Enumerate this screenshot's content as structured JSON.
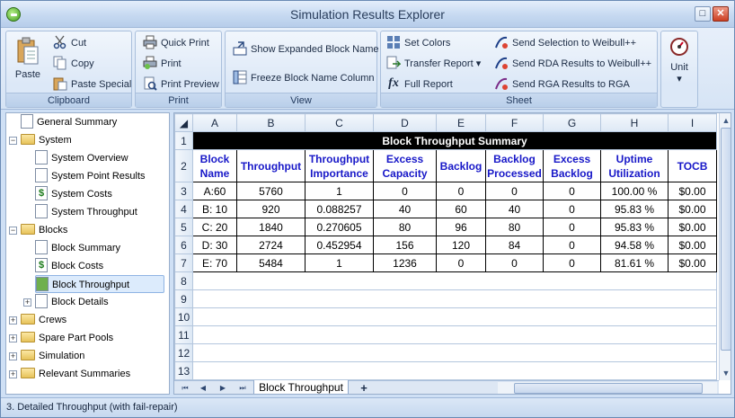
{
  "window": {
    "title": "Simulation Results Explorer",
    "maximize_glyph": "□",
    "close_glyph": "✕"
  },
  "ribbon": {
    "clipboard": {
      "label": "Clipboard",
      "paste": "Paste",
      "cut": "Cut",
      "copy": "Copy",
      "paste_special": "Paste Special"
    },
    "print": {
      "label": "Print",
      "quick_print": "Quick Print",
      "print": "Print",
      "print_preview": "Print Preview"
    },
    "view": {
      "label": "View",
      "show_expanded": "Show Expanded Block Name",
      "freeze": "Freeze Block Name Column"
    },
    "sheet": {
      "label": "Sheet",
      "set_colors": "Set Colors",
      "transfer_report": "Transfer Report",
      "full_report": "Full Report",
      "send_selection": "Send Selection to Weibull++",
      "send_rda": "Send RDA Results to Weibull++",
      "send_rga": "Send RGA Results to RGA"
    },
    "unit": {
      "label": "Unit",
      "dropdown_glyph": "▾"
    }
  },
  "nav": {
    "general_summary": "General Summary",
    "system": "System",
    "system_overview": "System Overview",
    "system_point_results": "System Point Results",
    "system_costs": "System Costs",
    "system_throughput": "System Throughput",
    "blocks": "Blocks",
    "block_summary": "Block Summary",
    "block_costs": "Block Costs",
    "block_throughput": "Block Throughput",
    "block_details": "Block Details",
    "crews": "Crews",
    "spare_part_pools": "Spare Part Pools",
    "simulation": "Simulation",
    "relevant_summaries": "Relevant Summaries"
  },
  "sheet": {
    "columns": [
      "A",
      "B",
      "C",
      "D",
      "E",
      "F",
      "G",
      "H",
      "I"
    ],
    "rows": [
      "1",
      "2",
      "3",
      "4",
      "5",
      "6",
      "7",
      "8",
      "9",
      "10",
      "11",
      "12",
      "13"
    ],
    "title": "Block Throughput Summary",
    "headers": [
      "Block Name",
      "Throughput",
      "Throughput Importance",
      "Excess Capacity",
      "Backlog",
      "Backlog Processed",
      "Excess Backlog",
      "Uptime Utilization",
      "TOCB"
    ],
    "data": [
      [
        "A:60",
        "5760",
        "1",
        "0",
        "0",
        "0",
        "0",
        "100.00 %",
        "$0.00"
      ],
      [
        "B: 10",
        "920",
        "0.088257",
        "40",
        "60",
        "40",
        "0",
        "95.83 %",
        "$0.00"
      ],
      [
        "C: 20",
        "1840",
        "0.270605",
        "80",
        "96",
        "80",
        "0",
        "95.83 %",
        "$0.00"
      ],
      [
        "D: 30",
        "2724",
        "0.452954",
        "156",
        "120",
        "84",
        "0",
        "94.58 %",
        "$0.00"
      ],
      [
        "E: 70",
        "5484",
        "1",
        "1236",
        "0",
        "0",
        "0",
        "81.61 %",
        "$0.00"
      ]
    ],
    "tab_label": "Block Throughput",
    "add_tab": "+",
    "first_glyph": "⏮",
    "prev_glyph": "◀",
    "next_glyph": "▶",
    "last_glyph": "⏭",
    "up_glyph": "▲",
    "down_glyph": "▼"
  },
  "status": {
    "text": "3. Detailed Throughput (with fail-repair)"
  }
}
